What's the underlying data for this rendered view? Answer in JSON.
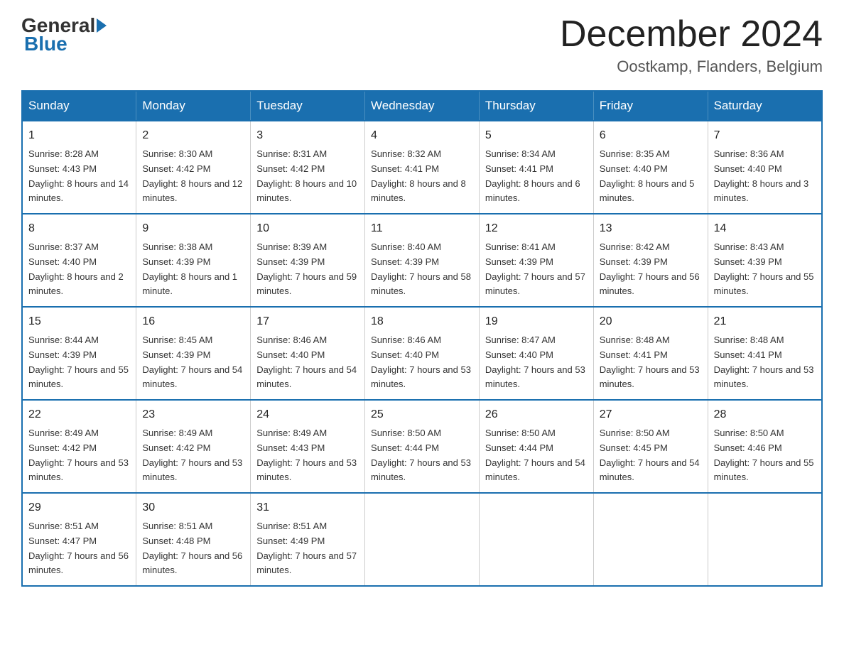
{
  "logo": {
    "general": "General",
    "blue": "Blue"
  },
  "title": {
    "month_year": "December 2024",
    "location": "Oostkamp, Flanders, Belgium"
  },
  "days_of_week": [
    "Sunday",
    "Monday",
    "Tuesday",
    "Wednesday",
    "Thursday",
    "Friday",
    "Saturday"
  ],
  "weeks": [
    [
      {
        "day": "1",
        "sunrise": "8:28 AM",
        "sunset": "4:43 PM",
        "daylight": "8 hours and 14 minutes."
      },
      {
        "day": "2",
        "sunrise": "8:30 AM",
        "sunset": "4:42 PM",
        "daylight": "8 hours and 12 minutes."
      },
      {
        "day": "3",
        "sunrise": "8:31 AM",
        "sunset": "4:42 PM",
        "daylight": "8 hours and 10 minutes."
      },
      {
        "day": "4",
        "sunrise": "8:32 AM",
        "sunset": "4:41 PM",
        "daylight": "8 hours and 8 minutes."
      },
      {
        "day": "5",
        "sunrise": "8:34 AM",
        "sunset": "4:41 PM",
        "daylight": "8 hours and 6 minutes."
      },
      {
        "day": "6",
        "sunrise": "8:35 AM",
        "sunset": "4:40 PM",
        "daylight": "8 hours and 5 minutes."
      },
      {
        "day": "7",
        "sunrise": "8:36 AM",
        "sunset": "4:40 PM",
        "daylight": "8 hours and 3 minutes."
      }
    ],
    [
      {
        "day": "8",
        "sunrise": "8:37 AM",
        "sunset": "4:40 PM",
        "daylight": "8 hours and 2 minutes."
      },
      {
        "day": "9",
        "sunrise": "8:38 AM",
        "sunset": "4:39 PM",
        "daylight": "8 hours and 1 minute."
      },
      {
        "day": "10",
        "sunrise": "8:39 AM",
        "sunset": "4:39 PM",
        "daylight": "7 hours and 59 minutes."
      },
      {
        "day": "11",
        "sunrise": "8:40 AM",
        "sunset": "4:39 PM",
        "daylight": "7 hours and 58 minutes."
      },
      {
        "day": "12",
        "sunrise": "8:41 AM",
        "sunset": "4:39 PM",
        "daylight": "7 hours and 57 minutes."
      },
      {
        "day": "13",
        "sunrise": "8:42 AM",
        "sunset": "4:39 PM",
        "daylight": "7 hours and 56 minutes."
      },
      {
        "day": "14",
        "sunrise": "8:43 AM",
        "sunset": "4:39 PM",
        "daylight": "7 hours and 55 minutes."
      }
    ],
    [
      {
        "day": "15",
        "sunrise": "8:44 AM",
        "sunset": "4:39 PM",
        "daylight": "7 hours and 55 minutes."
      },
      {
        "day": "16",
        "sunrise": "8:45 AM",
        "sunset": "4:39 PM",
        "daylight": "7 hours and 54 minutes."
      },
      {
        "day": "17",
        "sunrise": "8:46 AM",
        "sunset": "4:40 PM",
        "daylight": "7 hours and 54 minutes."
      },
      {
        "day": "18",
        "sunrise": "8:46 AM",
        "sunset": "4:40 PM",
        "daylight": "7 hours and 53 minutes."
      },
      {
        "day": "19",
        "sunrise": "8:47 AM",
        "sunset": "4:40 PM",
        "daylight": "7 hours and 53 minutes."
      },
      {
        "day": "20",
        "sunrise": "8:48 AM",
        "sunset": "4:41 PM",
        "daylight": "7 hours and 53 minutes."
      },
      {
        "day": "21",
        "sunrise": "8:48 AM",
        "sunset": "4:41 PM",
        "daylight": "7 hours and 53 minutes."
      }
    ],
    [
      {
        "day": "22",
        "sunrise": "8:49 AM",
        "sunset": "4:42 PM",
        "daylight": "7 hours and 53 minutes."
      },
      {
        "day": "23",
        "sunrise": "8:49 AM",
        "sunset": "4:42 PM",
        "daylight": "7 hours and 53 minutes."
      },
      {
        "day": "24",
        "sunrise": "8:49 AM",
        "sunset": "4:43 PM",
        "daylight": "7 hours and 53 minutes."
      },
      {
        "day": "25",
        "sunrise": "8:50 AM",
        "sunset": "4:44 PM",
        "daylight": "7 hours and 53 minutes."
      },
      {
        "day": "26",
        "sunrise": "8:50 AM",
        "sunset": "4:44 PM",
        "daylight": "7 hours and 54 minutes."
      },
      {
        "day": "27",
        "sunrise": "8:50 AM",
        "sunset": "4:45 PM",
        "daylight": "7 hours and 54 minutes."
      },
      {
        "day": "28",
        "sunrise": "8:50 AM",
        "sunset": "4:46 PM",
        "daylight": "7 hours and 55 minutes."
      }
    ],
    [
      {
        "day": "29",
        "sunrise": "8:51 AM",
        "sunset": "4:47 PM",
        "daylight": "7 hours and 56 minutes."
      },
      {
        "day": "30",
        "sunrise": "8:51 AM",
        "sunset": "4:48 PM",
        "daylight": "7 hours and 56 minutes."
      },
      {
        "day": "31",
        "sunrise": "8:51 AM",
        "sunset": "4:49 PM",
        "daylight": "7 hours and 57 minutes."
      },
      null,
      null,
      null,
      null
    ]
  ]
}
